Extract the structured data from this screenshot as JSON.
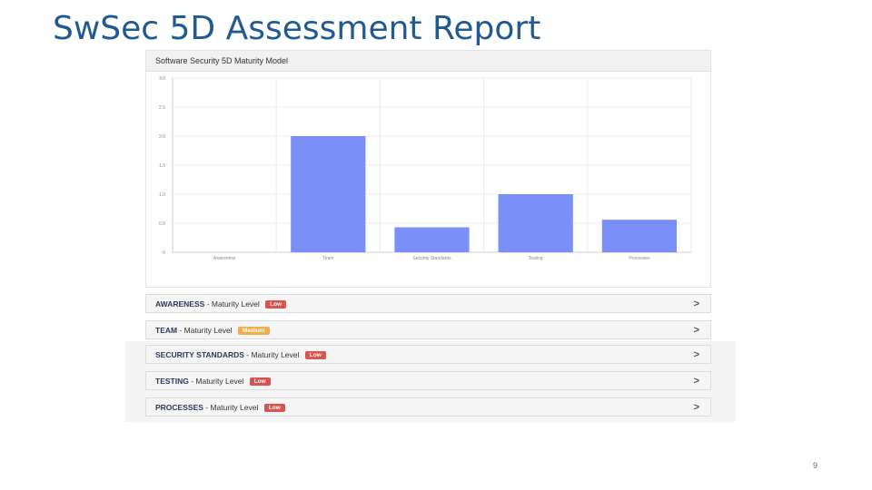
{
  "slide": {
    "title": "SwSec 5D Assessment Report",
    "page_number": "9"
  },
  "chart_panel": {
    "header": "Software Security 5D Maturity Model"
  },
  "chart_data": {
    "type": "bar",
    "title": "Software Security 5D Maturity Model",
    "categories": [
      "Awareness",
      "Team",
      "Security Standards",
      "Testing",
      "Processes"
    ],
    "values": [
      0,
      2.0,
      0.43,
      1.0,
      0.56
    ],
    "ylim": [
      0,
      3.0
    ],
    "yticks": [
      "0",
      "0.5",
      "1.0",
      "1.5",
      "2.0",
      "2.5",
      "3.0"
    ],
    "xlabel": "",
    "ylabel": "",
    "grid": true,
    "bar_color": "#7b8ff8"
  },
  "levels": [
    {
      "category": "AWARENESS",
      "suffix": " - Maturity Level",
      "badge": "Low",
      "status": "low"
    },
    {
      "category": "TEAM",
      "suffix": " - Maturity Level",
      "badge": "Medium",
      "status": "medium"
    },
    {
      "category": "SECURITY STANDARDS",
      "suffix": " - Maturity Level",
      "badge": "Low",
      "status": "low"
    },
    {
      "category": "TESTING",
      "suffix": " - Maturity Level",
      "badge": "Low",
      "status": "low"
    },
    {
      "category": "PROCESSES",
      "suffix": " - Maturity Level",
      "badge": "Low",
      "status": "low"
    }
  ],
  "icons": {
    "expand": "chevron-right-icon",
    "expand_glyph": ">"
  }
}
